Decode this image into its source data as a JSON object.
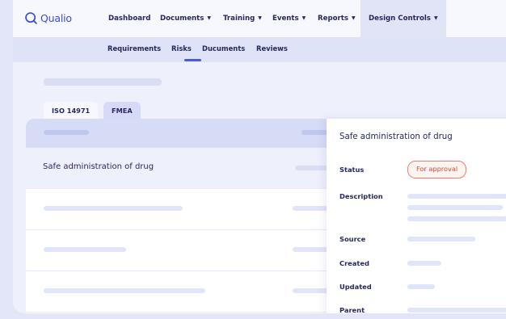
{
  "app": {
    "name": "Qualio",
    "brand_color": "#3d4cd3",
    "logo_icon": "search-icon"
  },
  "topnav": {
    "items": [
      {
        "label": "Dashboard",
        "has_caret": false
      },
      {
        "label": "Documents",
        "has_caret": true
      },
      {
        "label": "Training",
        "has_caret": true
      },
      {
        "label": "Events",
        "has_caret": true
      },
      {
        "label": "Reports",
        "has_caret": true
      },
      {
        "label": "Design Controls",
        "has_caret": true,
        "active": true
      }
    ],
    "caret_icon": "chevron-down-icon"
  },
  "subnav": {
    "items": [
      {
        "label": "Requirements"
      },
      {
        "label": "Risks",
        "active": true
      },
      {
        "label": "Ducuments"
      },
      {
        "label": "Reviews"
      }
    ],
    "accent_color": "#4d5cd6"
  },
  "tabs": [
    {
      "label": "ISO 14971",
      "active": false
    },
    {
      "label": "FMEA",
      "active": true
    }
  ],
  "table": {
    "selected_row": {
      "title": "Safe administration of drug"
    }
  },
  "detail": {
    "title": "Safe administration of drug",
    "status_label": "Status",
    "status_value": "For approval",
    "status_color": "#ef7d6b",
    "description_label": "Description",
    "source_label": "Source",
    "created_label": "Created",
    "updated_label": "Updated",
    "parent_label": "Parent"
  }
}
